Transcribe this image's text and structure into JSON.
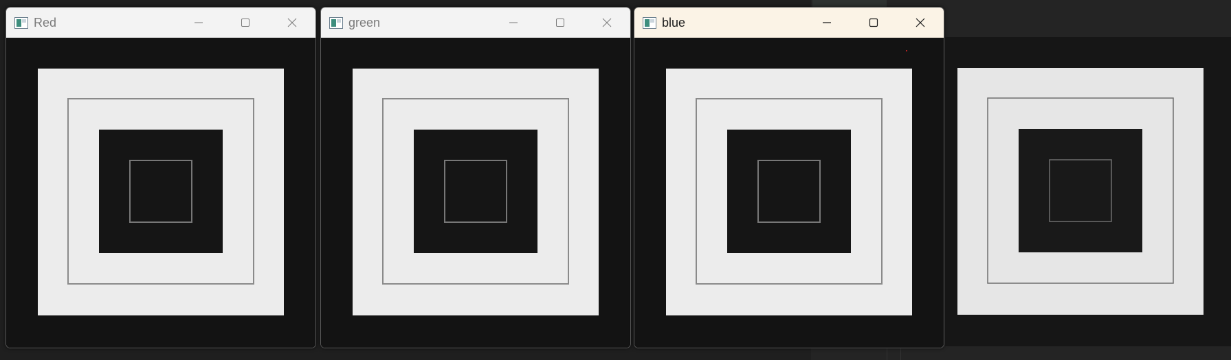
{
  "windows": [
    {
      "title": "Red",
      "active": false
    },
    {
      "title": "green",
      "active": false
    },
    {
      "title": "blue",
      "active": true
    }
  ],
  "icons": {
    "app": "opencv-window-icon",
    "minimize": "minimize-icon",
    "maximize": "maximize-icon",
    "close": "close-icon"
  },
  "colors": {
    "titlebar_inactive": "#f3f3f3",
    "titlebar_active": "#fbf3e6",
    "image_dark": "#141414",
    "image_light": "#ececec",
    "outline_gray": "#7d7d7d"
  }
}
